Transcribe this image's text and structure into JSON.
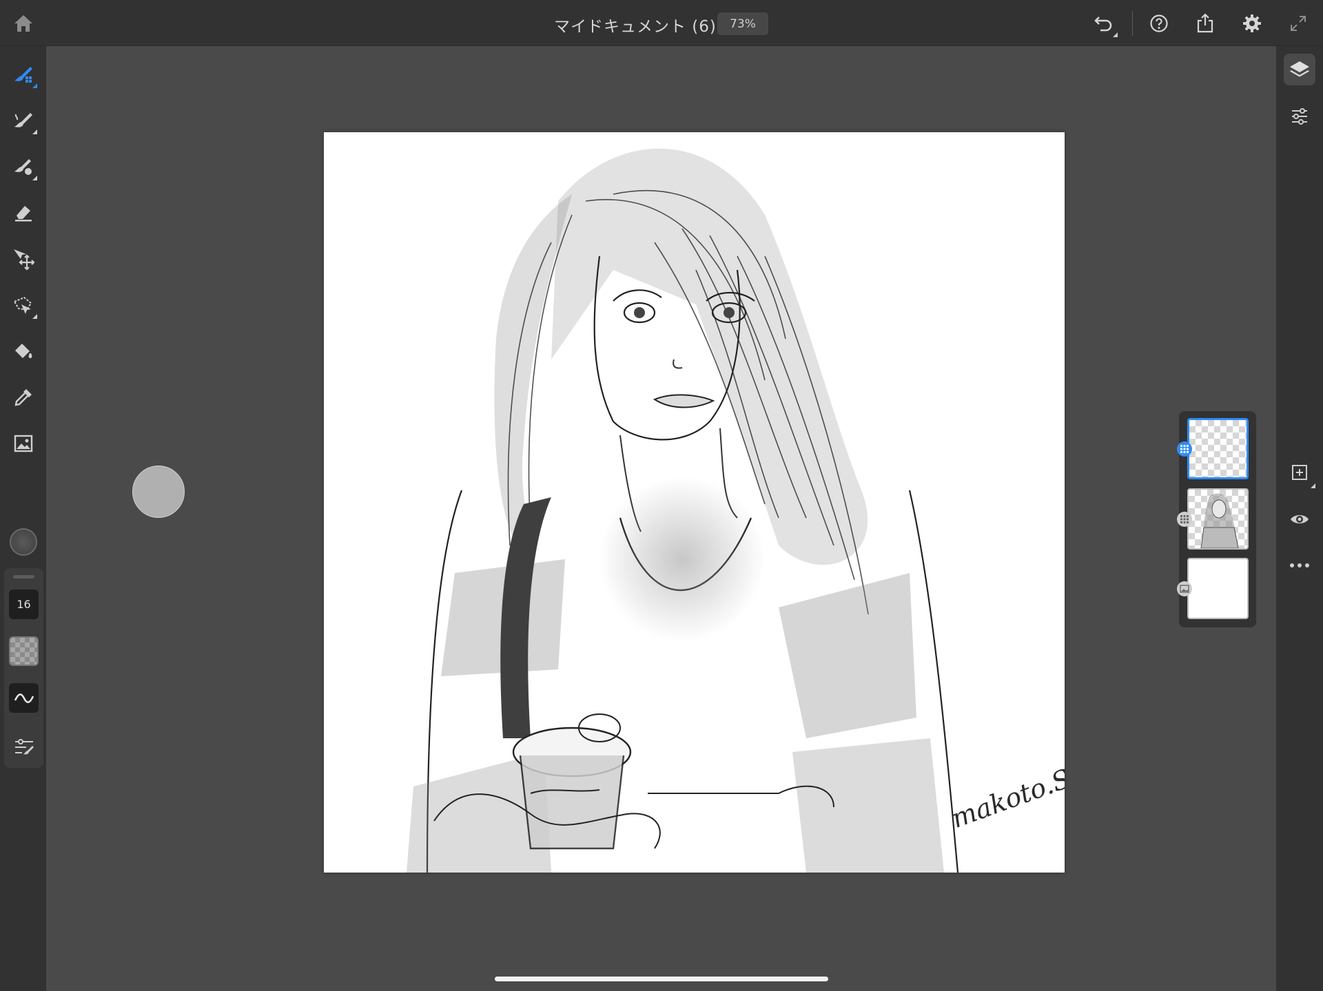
{
  "header": {
    "document_title": "マイドキュメント (6)",
    "zoom_level": "73%"
  },
  "tools": {
    "brush_size": "16"
  },
  "canvas": {
    "signature": "makoto.S"
  },
  "layers": {
    "count": 3,
    "selected_index": 0
  },
  "colors": {
    "ui_dark": "#323232",
    "workspace": "#4a4a4a",
    "accent_blue": "#2f8bf5",
    "icon_light": "#cfcfcf"
  },
  "icons": {
    "top": [
      "home-icon",
      "undo-icon",
      "help-icon",
      "share-icon",
      "settings-icon",
      "fullscreen-icon"
    ],
    "left": [
      "pixel-brush-icon",
      "live-brush-icon",
      "vector-brush-icon",
      "eraser-icon",
      "move-transform-icon",
      "lasso-select-icon",
      "fill-bucket-icon",
      "eyedropper-icon",
      "image-import-icon"
    ],
    "right": [
      "layers-icon",
      "layer-properties-icon",
      "add-layer-icon",
      "visibility-icon",
      "more-options-icon"
    ]
  }
}
